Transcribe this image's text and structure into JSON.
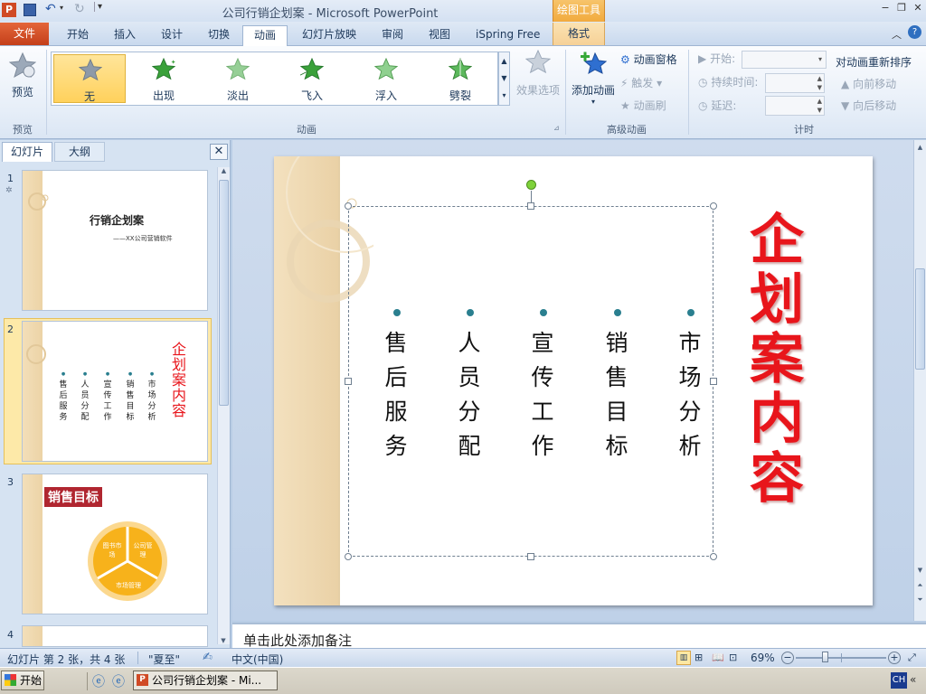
{
  "titlebar": {
    "title": "公司行销企划案 - Microsoft PowerPoint",
    "contextual_tab_group": "绘图工具",
    "minimize": "−",
    "restore": "❐",
    "close": "✕"
  },
  "tabs": {
    "file": "文件",
    "items": [
      "开始",
      "插入",
      "设计",
      "切换",
      "动画",
      "幻灯片放映",
      "审阅",
      "视图",
      "iSpring Free"
    ],
    "active": "动画",
    "format": "格式"
  },
  "ribbon": {
    "preview": {
      "label": "预览",
      "group": "预览"
    },
    "animations": {
      "group": "动画",
      "items": [
        {
          "label": "无",
          "selected": true
        },
        {
          "label": "出现"
        },
        {
          "label": "淡出"
        },
        {
          "label": "飞入"
        },
        {
          "label": "浮入"
        },
        {
          "label": "劈裂"
        }
      ],
      "effect_options": "效果选项"
    },
    "advanced": {
      "group": "高级动画",
      "add_animation": "添加动画",
      "animation_pane": "动画窗格",
      "trigger": "触发",
      "animation_painter": "动画刷"
    },
    "timing": {
      "group": "计时",
      "start": "开始:",
      "duration": "持续时间:",
      "delay": "延迟:",
      "reorder": "对动画重新排序",
      "move_earlier": "向前移动",
      "move_later": "向后移动"
    }
  },
  "left_panel": {
    "tab_slides": "幻灯片",
    "tab_outline": "大纲",
    "close": "✕",
    "thumbs": [
      {
        "num": "1",
        "title": "行销企划案",
        "subtitle": "——XX公司营销软件"
      },
      {
        "num": "2",
        "columns": [
          "售后服务",
          "人员分配",
          "宣传工作",
          "销售目标",
          "市场分析"
        ],
        "title": "企划案内容"
      },
      {
        "num": "3",
        "title": "销售目标",
        "segments": [
          "图书市场",
          "公司管理",
          "市场管理"
        ]
      },
      {
        "num": "4"
      }
    ]
  },
  "slide": {
    "title": "企划案内容",
    "columns": [
      "售后服务",
      "人员分配",
      "宣传工作",
      "销售目标",
      "市场分析"
    ]
  },
  "notes": {
    "placeholder": "单击此处添加备注"
  },
  "statusbar": {
    "slide_info": "幻灯片 第 2 张，共 4 张",
    "theme": "\"夏至\"",
    "language": "中文(中国)",
    "zoom": "69%",
    "zoom_value": 69
  },
  "taskbar": {
    "start": "开始",
    "task": "公司行销企划案 - Mi...",
    "lang": "CH",
    "tray_arrow": "«"
  },
  "colors": {
    "title_red": "#e8151b",
    "file_tab": "#d24e26",
    "selected_gallery": "#ffd15c",
    "bullet": "#2a7f8f"
  }
}
